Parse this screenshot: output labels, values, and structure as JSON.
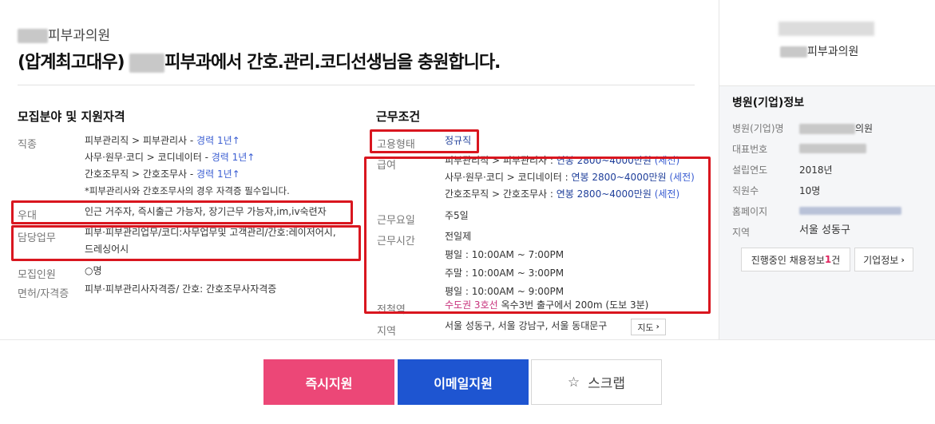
{
  "header": {
    "company_suffix": "피부과의원",
    "title_prefix": "(압계최고대우) ",
    "title_suffix": "피부과에서 간호.관리.코디선생님을 충원합니다."
  },
  "left": {
    "section_title": "모집분야 및 지원자격",
    "field_label": "직종",
    "fields": [
      {
        "path": "피부관리직 > 피부관리사 - ",
        "exp": "경력 1년↑"
      },
      {
        "path": "사무·원무·코디 > 코디네이터 - ",
        "exp": "경력 1년↑"
      },
      {
        "path": "간호조무직 > 간호조무사 - ",
        "exp": "경력 1년↑"
      }
    ],
    "field_note": "*피부관리사와 간호조무사의 경우 자격증 필수입니다.",
    "pref_label": "우대",
    "pref_value": "인근 거주자, 즉시출근 가능자, 장기근무 가능자,im,iv숙련자",
    "duty_label": "담당업무",
    "duty_line1": "피부·피부관리업무/코디:사무업무및 고객관리/간호:레이저어시,",
    "duty_line2": "드레싱어시",
    "count_label": "모집인원",
    "count_value": "○명",
    "license_label": "면허/자격증",
    "license_value": "피부·피부관리사자격증/ 간호: 간호조무사자격증"
  },
  "right": {
    "section_title": "근무조건",
    "emp_label": "고용형태",
    "emp_value": "정규직",
    "salary_label": "급여",
    "salaries": [
      {
        "path": "피부관리직 > 피부관리사 : ",
        "amount": "연봉 2800~4000만원",
        "tax": " (세전)"
      },
      {
        "path": "사무·원무·코디 > 코디네이터 : ",
        "amount": "연봉 2800~4000만원",
        "tax": " (세전)"
      },
      {
        "path": "간호조무직 > 간호조무사 : ",
        "amount": "연봉 2800~4000만원",
        "tax": " (세전)"
      }
    ],
    "days_label": "근무요일",
    "days_value": "주5일",
    "hours_label": "근무시간",
    "hours": [
      "전일제",
      "평일 : 10:00AM ~ 7:00PM",
      "주말 : 10:00AM ~ 3:00PM",
      "평일 : 10:00AM ~ 9:00PM"
    ],
    "subway_label": "전철역",
    "subway_line": "수도권 3호선",
    "subway_desc": " 옥수3번 출구에서 200m (도보 3분)",
    "region_label": "지역",
    "region_value": "서울 성동구, 서울 강남구, 서울 동대문구",
    "map_button": "지도"
  },
  "sidebar": {
    "company_name": "피부과의원",
    "info_title": "병원(기업)정보",
    "rows": [
      {
        "label": "병원(기업)명",
        "value": "의원"
      },
      {
        "label": "대표번호",
        "value": ""
      },
      {
        "label": "설립연도",
        "value": "2018년"
      },
      {
        "label": "직원수",
        "value": "10명"
      },
      {
        "label": "홈페이지",
        "value": ""
      },
      {
        "label": "지역",
        "value": "서울 성동구"
      }
    ],
    "jobs_button_prefix": "진행중인 채용정보 ",
    "jobs_count": "1",
    "jobs_button_suffix": "건",
    "company_button": "기업정보"
  },
  "actions": {
    "apply_now": "즉시지원",
    "email_apply": "이메일지원",
    "scrap": "스크랩"
  },
  "colors": {
    "apply_now": "#ec4777",
    "email_apply": "#1e55d1",
    "highlight_box": "#d9161f",
    "link_blue": "#3b5ed2"
  }
}
